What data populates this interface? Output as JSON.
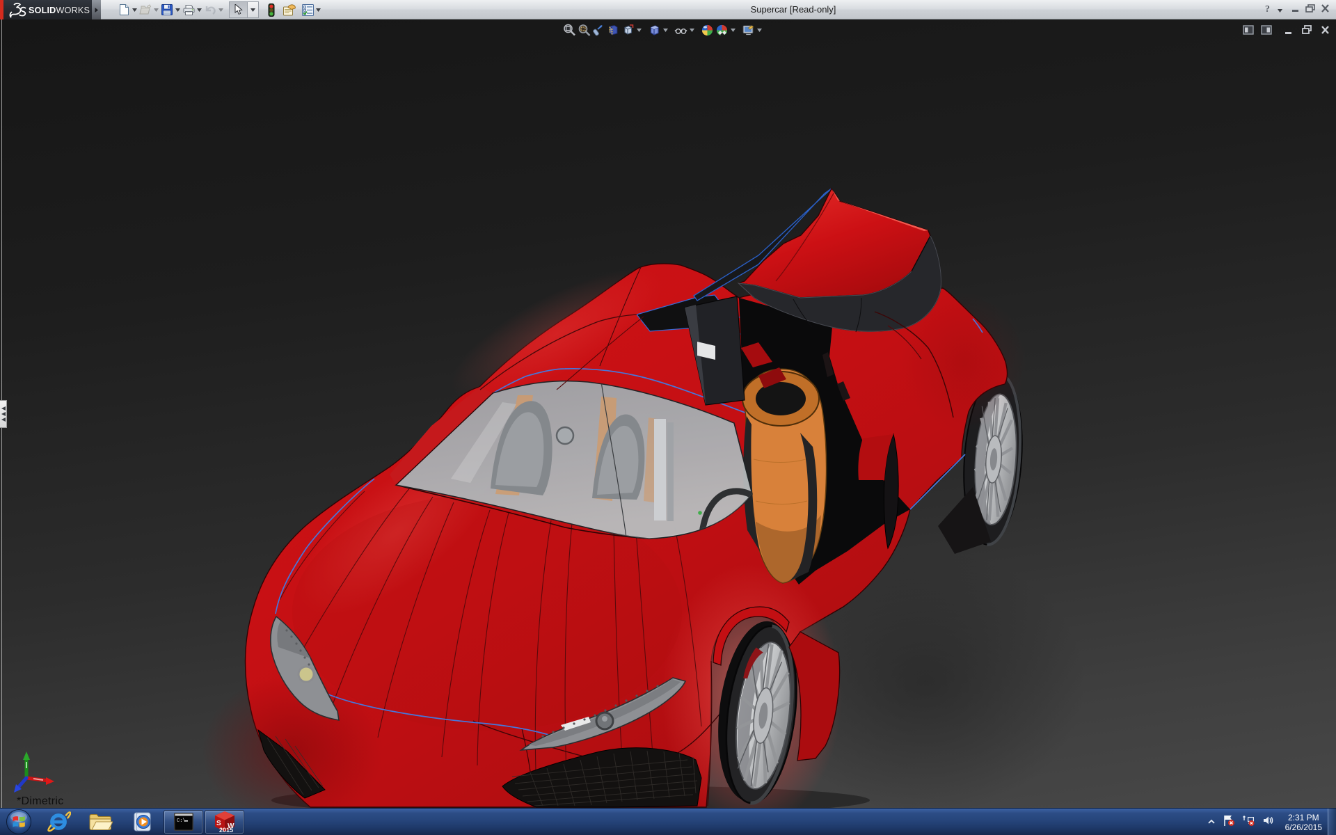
{
  "window": {
    "brand": "SOLIDWORKS",
    "brand_bold": "SOLID",
    "brand_light": "WORKS",
    "help_glyph": "?",
    "title": "Supercar [Read-only]",
    "titlebar_controls": [
      "help",
      "help-dropdown",
      "minimize",
      "restore",
      "close"
    ]
  },
  "main_toolbar": {
    "items": [
      {
        "name": "new",
        "dropdown": true
      },
      {
        "name": "open",
        "dropdown": true,
        "disabled": true
      },
      {
        "name": "save",
        "dropdown": true
      },
      {
        "name": "print",
        "dropdown": true
      },
      {
        "name": "undo",
        "dropdown": true,
        "disabled": true
      },
      {
        "name": "select",
        "dropdown": true,
        "pressed": true
      },
      {
        "name": "options-traffic-light",
        "dropdown": false
      },
      {
        "name": "file-properties",
        "dropdown": false
      },
      {
        "name": "design-checker",
        "dropdown": true
      }
    ]
  },
  "heads_up_toolbar": {
    "items": [
      {
        "name": "zoom-to-fit"
      },
      {
        "name": "zoom-to-area"
      },
      {
        "name": "previous-view"
      },
      {
        "name": "section-view"
      },
      {
        "name": "view-orientation",
        "dropdown": true
      },
      {
        "name": "display-style",
        "dropdown": true
      },
      {
        "name": "hide-show-items",
        "dropdown": true
      },
      {
        "name": "edit-appearance"
      },
      {
        "name": "apply-scene",
        "dropdown": true
      },
      {
        "name": "view-settings",
        "dropdown": true
      }
    ]
  },
  "document_window": {
    "controls": [
      "tile-left",
      "tile-right",
      "minimize",
      "restore",
      "close"
    ]
  },
  "viewport": {
    "view_label": "*Dimetric",
    "model": "red supercar with open gullwing door, orange seats",
    "triad_axes": [
      "x-red",
      "y-green",
      "z-blue"
    ]
  },
  "taskbar": {
    "buttons": [
      {
        "name": "start"
      },
      {
        "name": "internet-explorer"
      },
      {
        "name": "windows-explorer"
      },
      {
        "name": "windows-media-player"
      },
      {
        "name": "command-prompt",
        "open": true
      },
      {
        "name": "solidworks-2015",
        "open": true,
        "badge": "2015"
      }
    ],
    "cmd_label": "C:\\",
    "solidworks_year": "2015",
    "tray": {
      "icons": [
        "show-hidden",
        "action-center-flag",
        "network-error",
        "volume"
      ],
      "time": "2:31 PM",
      "date": "6/26/2015"
    }
  },
  "colors": {
    "taskbar_blue": "#27447c",
    "car_red": "#cc0d0d",
    "seat_orange": "#e08a30",
    "accent_blue": "#3a6ad4"
  }
}
